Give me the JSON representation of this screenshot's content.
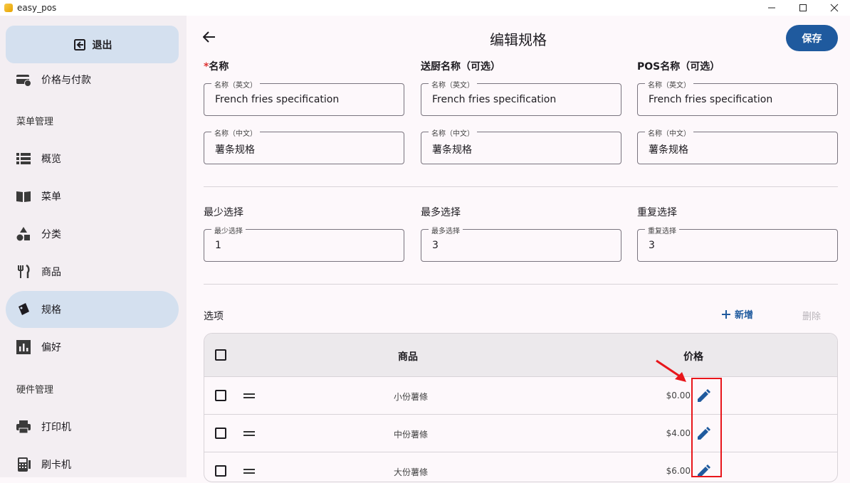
{
  "window": {
    "title": "easy_pos",
    "min": "—",
    "max": "☐",
    "close": "✕"
  },
  "sidebar": {
    "logout_label": "退出",
    "items": [
      {
        "label": "价格与付款",
        "icon": "payment-icon"
      },
      {
        "label": "概览",
        "icon": "list-icon"
      },
      {
        "label": "菜单",
        "icon": "book-icon"
      },
      {
        "label": "分类",
        "icon": "category-icon"
      },
      {
        "label": "商品",
        "icon": "fork-knife-icon"
      },
      {
        "label": "规格",
        "icon": "tag-icon"
      },
      {
        "label": "偏好",
        "icon": "chart-icon"
      },
      {
        "label": "打印机",
        "icon": "printer-icon"
      },
      {
        "label": "刷卡机",
        "icon": "card-reader-icon"
      }
    ],
    "sections": {
      "menu_mgmt": "菜单管理",
      "hardware_mgmt": "硬件管理"
    }
  },
  "header": {
    "title": "编辑规格",
    "save_label": "保存"
  },
  "names": {
    "col1": {
      "required": "*",
      "label": "名称"
    },
    "col2": {
      "label": "送厨名称（可选）"
    },
    "col3": {
      "label": "POS名称（可选）"
    },
    "en_label": "名称（英文）",
    "zh_label": "名称（中文）",
    "en_value": "French fries specification",
    "zh_value": "薯条规格"
  },
  "selection": {
    "min": {
      "label": "最少选择",
      "value": "1"
    },
    "max": {
      "label": "最多选择",
      "value": "3"
    },
    "repeat": {
      "label": "重复选择",
      "value": "3"
    }
  },
  "options": {
    "title": "选项",
    "add_label": "新增",
    "delete_label": "删除",
    "headers": {
      "product": "商品",
      "price": "价格"
    },
    "rows": [
      {
        "name": "小份薯條",
        "price": "$0.00"
      },
      {
        "name": "中份薯條",
        "price": "$4.00"
      },
      {
        "name": "大份薯條",
        "price": "$6.00"
      }
    ]
  },
  "colors": {
    "primary": "#1f5a9e",
    "active_nav": "#d4e0ef",
    "annotation": "#e8161b"
  }
}
